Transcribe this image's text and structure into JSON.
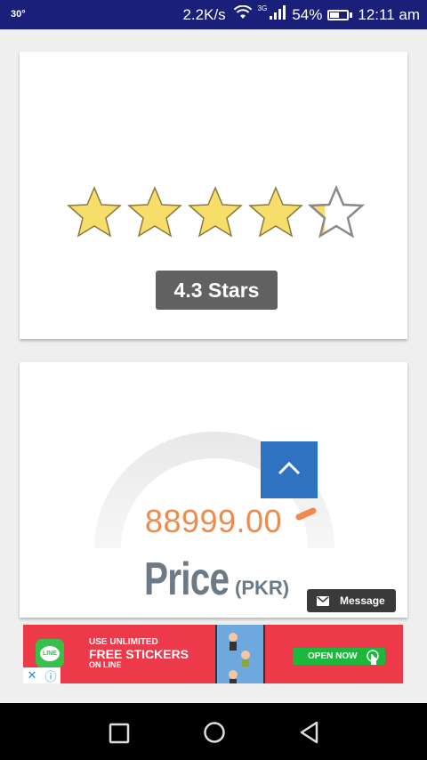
{
  "status_bar": {
    "temperature": "30°",
    "network_speed": "2.2K/s",
    "network_type": "3G",
    "battery": "54%",
    "battery_level": 0.54,
    "time": "12:11 am",
    "icons": [
      "wifi-icon",
      "signal-icon",
      "battery-icon"
    ]
  },
  "rating": {
    "value": 4.3,
    "max": 5,
    "label": "4.3 Stars",
    "star_color": "#f7dd6a"
  },
  "price": {
    "value": "88999.00",
    "label": "Price",
    "unit": "(PKR)",
    "accent_color": "#f08a4b"
  },
  "scroll_top": {
    "icon": "chevron-up-icon",
    "color": "#2f72c0"
  },
  "message_button": {
    "label": "Message",
    "icon": "mail-icon"
  },
  "ad": {
    "line1": "USE UNLIMITED",
    "line2": "FREE STICKERS",
    "line3": "ON LINE",
    "logo_text": "LINE",
    "cta": "OPEN NOW",
    "background": "#ec3a4a"
  },
  "nav": {
    "recents": "square-icon",
    "home": "circle-icon",
    "back": "triangle-back-icon"
  }
}
